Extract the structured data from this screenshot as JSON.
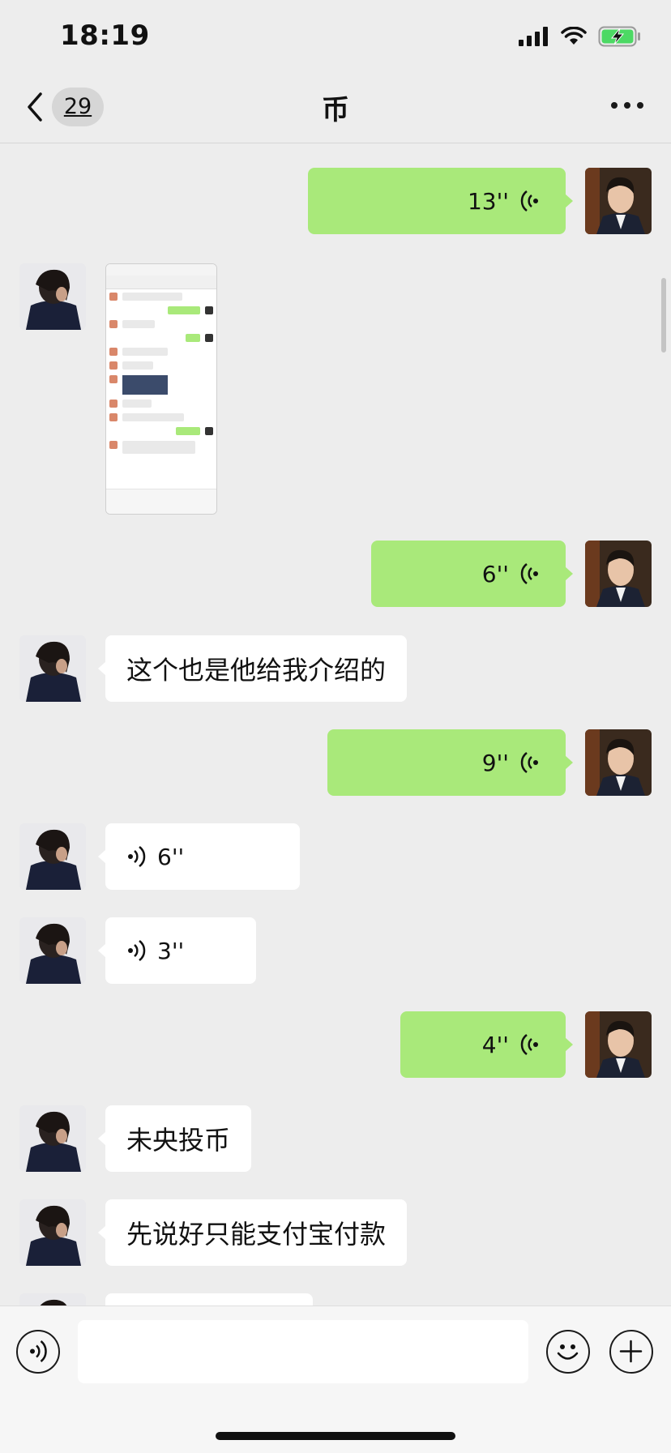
{
  "status_bar": {
    "time": "18:19"
  },
  "nav": {
    "unread_count": "29",
    "title": "币"
  },
  "messages": [
    {
      "side": "out",
      "type": "voice",
      "duration": "13''"
    },
    {
      "side": "in",
      "type": "image",
      "description": "screenshot"
    },
    {
      "side": "out",
      "type": "voice",
      "duration": "6''"
    },
    {
      "side": "in",
      "type": "text",
      "text": "这个也是他给我介绍的"
    },
    {
      "side": "out",
      "type": "voice",
      "duration": "9''"
    },
    {
      "side": "in",
      "type": "voice",
      "duration": "6''"
    },
    {
      "side": "in",
      "type": "voice",
      "duration": "3''"
    },
    {
      "side": "out",
      "type": "voice",
      "duration": "4''"
    },
    {
      "side": "in",
      "type": "text",
      "text": "未央投币"
    },
    {
      "side": "in",
      "type": "text",
      "text": "先说好只能支付宝付款"
    }
  ],
  "input": {
    "placeholder": ""
  },
  "icons": [
    "back-chevron",
    "more-dots",
    "voice-mode",
    "emoji",
    "plus",
    "signal",
    "wifi",
    "battery-charging"
  ],
  "colors": {
    "sent_bubble": "#a9e97a",
    "received_bubble": "#ffffff",
    "background": "#ededed",
    "battery": "#4cd964"
  }
}
